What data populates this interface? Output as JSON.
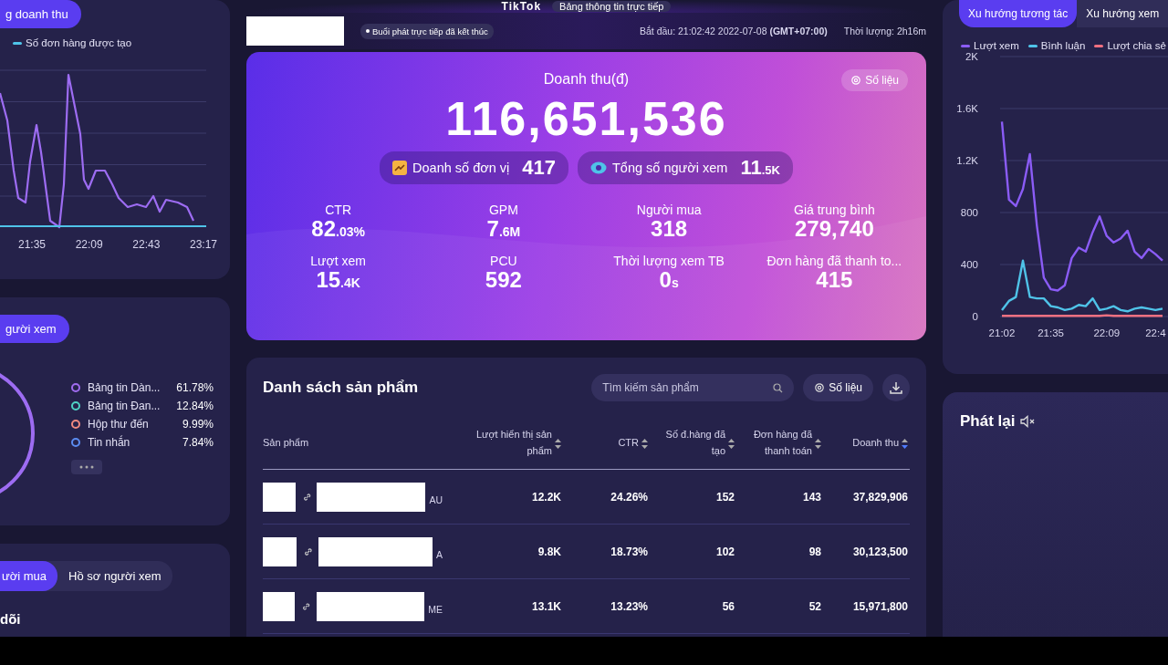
{
  "header": {
    "logo": "TikTok",
    "title": "Bảng thông tin trực tiếp"
  },
  "left_panel": {
    "sales_card": {
      "tab": "g doanh thu",
      "legend": [
        {
          "label": "Số đơn hàng được tạo",
          "color": "#4fc3e8"
        }
      ],
      "x_labels": [
        "21:35",
        "22:09",
        "22:43",
        "23:17"
      ]
    },
    "traffic_card": {
      "tab": "gười xem",
      "sources": [
        {
          "label": "Bảng tin Dàn...",
          "share": "61.78%",
          "color": "#a06cf0"
        },
        {
          "label": "Bảng tin Đan...",
          "share": "12.84%",
          "color": "#4fd1c5"
        },
        {
          "label": "Hộp thư đến",
          "share": "9.99%",
          "color": "#f08a80"
        },
        {
          "label": "Tin nhắn",
          "share": "7.84%",
          "color": "#5b8cf0"
        }
      ]
    },
    "profile_card": {
      "tabs": [
        {
          "label": "ười mua",
          "selected": true
        },
        {
          "label": "Hồ sơ người xem",
          "selected": false
        }
      ],
      "heading": "dõi"
    }
  },
  "session": {
    "status": "Buổi phát trực tiếp đã kết thúc",
    "start": "Bắt đầu: 21:02:42 2022-07-08 **(GMT+07:00)**",
    "duration": "Thời lượng: 2h16m"
  },
  "revenue": {
    "label": "Doanh thu(đ)",
    "metrics_button": "Số liệu",
    "value": "116,651,536",
    "highlights": [
      {
        "kind": "sales",
        "label": "Doanh số đơn vị",
        "value": "417"
      },
      {
        "kind": "viewers",
        "label": "Tổng số người xem",
        "value": "11",
        "suffix": ".5K"
      }
    ],
    "stats": [
      {
        "label": "CTR",
        "value": "82",
        "suffix": ".03%"
      },
      {
        "label": "GPM",
        "value": "7",
        "suffix": ".6M"
      },
      {
        "label": "Người mua",
        "value": "318"
      },
      {
        "label": "Giá trung bình",
        "value": "279,740"
      },
      {
        "label": "Lượt xem",
        "value": "15",
        "suffix": ".4K"
      },
      {
        "label": "PCU",
        "value": "592"
      },
      {
        "label": "Thời lượng xem TB",
        "value": "0",
        "suffix": "s"
      },
      {
        "label": "Đơn hàng đã thanh to...",
        "value": "415"
      }
    ]
  },
  "products": {
    "title": "Danh sách sản phẩm",
    "search": {
      "placeholder": "Tìm kiếm sản phẩm"
    },
    "metrics_button": "Số liệu",
    "columns": [
      {
        "label": "Sản phẩm"
      },
      {
        "label": "Lượt hiển thị sản phẩm",
        "sorted": false
      },
      {
        "label": "CTR",
        "sorted": false
      },
      {
        "label": "Số đ.hàng đã tạo",
        "sorted": false
      },
      {
        "label": "Đơn hàng đã thanh toán",
        "sorted": false
      },
      {
        "label": "Doanh thu",
        "sorted": true
      }
    ],
    "rows": [
      {
        "cells": [
          "AU",
          "12.2K",
          "24.26%",
          "152",
          "143",
          "37,829,906"
        ]
      },
      {
        "cells": [
          "A",
          "9.8K",
          "18.73%",
          "102",
          "98",
          "30,123,500"
        ]
      },
      {
        "cells": [
          "ME",
          "13.1K",
          "13.23%",
          "56",
          "52",
          "15,971,800"
        ]
      }
    ]
  },
  "right_panel": {
    "trend_tabs": [
      {
        "label": "Xu hướng tương tác",
        "selected": true
      },
      {
        "label": "Xu hướng xem",
        "selected": false
      }
    ],
    "chart_data": {
      "type": "line",
      "grid": true,
      "ylim": [
        0,
        2000
      ],
      "categories": [
        "21:02",
        null,
        null,
        null,
        null,
        null,
        null,
        "21:35",
        null,
        null,
        null,
        null,
        null,
        null,
        null,
        "22:09",
        null,
        null,
        null,
        null,
        null,
        null,
        "22:4",
        null
      ],
      "yticks": [
        0,
        400,
        800,
        {
          "value": 1200,
          "label": "1.2K"
        },
        {
          "value": 1600,
          "label": "1.6K"
        },
        {
          "value": 2000,
          "label": "2K"
        }
      ],
      "series": [
        {
          "name": "Lượt xem",
          "color": "#8b5cf6",
          "values": [
            1500,
            900,
            850,
            980,
            1250,
            700,
            300,
            210,
            200,
            240,
            450,
            530,
            500,
            650,
            770,
            620,
            570,
            600,
            660,
            500,
            450,
            520,
            480,
            430
          ]
        },
        {
          "name": "Bình luận",
          "color": "#4fc3e8",
          "values": [
            50,
            120,
            150,
            430,
            150,
            140,
            140,
            80,
            70,
            50,
            60,
            90,
            80,
            140,
            50,
            60,
            80,
            50,
            40,
            60,
            70,
            60,
            50,
            60
          ]
        },
        {
          "name": "Lượt chia sẻ",
          "color": "#f07080",
          "values": [
            5,
            5,
            5,
            5,
            5,
            5,
            5,
            5,
            5,
            5,
            5,
            5,
            5,
            5,
            5,
            10,
            5,
            5,
            5,
            5,
            5,
            5,
            5,
            5
          ]
        }
      ]
    },
    "replay": {
      "title": "Phát lại"
    }
  }
}
